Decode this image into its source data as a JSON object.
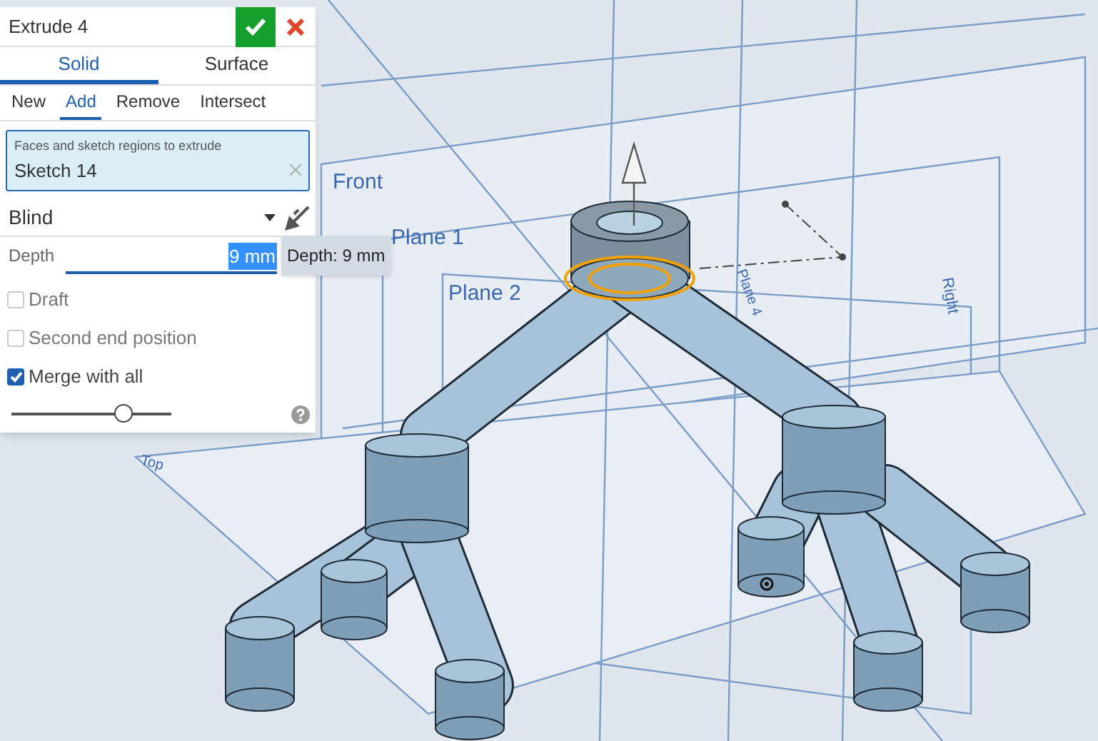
{
  "feature": {
    "title": "Extrude 4"
  },
  "body_tabs": [
    {
      "label": "Solid",
      "selected": true
    },
    {
      "label": "Surface",
      "selected": false
    }
  ],
  "operation_tabs": [
    {
      "label": "New",
      "selected": false
    },
    {
      "label": "Add",
      "selected": true
    },
    {
      "label": "Remove",
      "selected": false
    },
    {
      "label": "Intersect",
      "selected": false
    }
  ],
  "selection": {
    "label": "Faces and sketch regions to extrude",
    "items": [
      "Sketch 14"
    ]
  },
  "end_type": {
    "value": "Blind"
  },
  "depth": {
    "label": "Depth",
    "value": "9 mm",
    "tooltip": "Depth: 9 mm"
  },
  "options": [
    {
      "label": "Draft",
      "checked": false
    },
    {
      "label": "Second end position",
      "checked": false
    },
    {
      "label": "Merge with all",
      "checked": true
    }
  ],
  "slider": {
    "level": 0.7
  },
  "viewport": {
    "planes": [
      "Front",
      "Plane 1",
      "Plane 2",
      "Plane 4",
      "Right",
      "Top"
    ]
  }
}
